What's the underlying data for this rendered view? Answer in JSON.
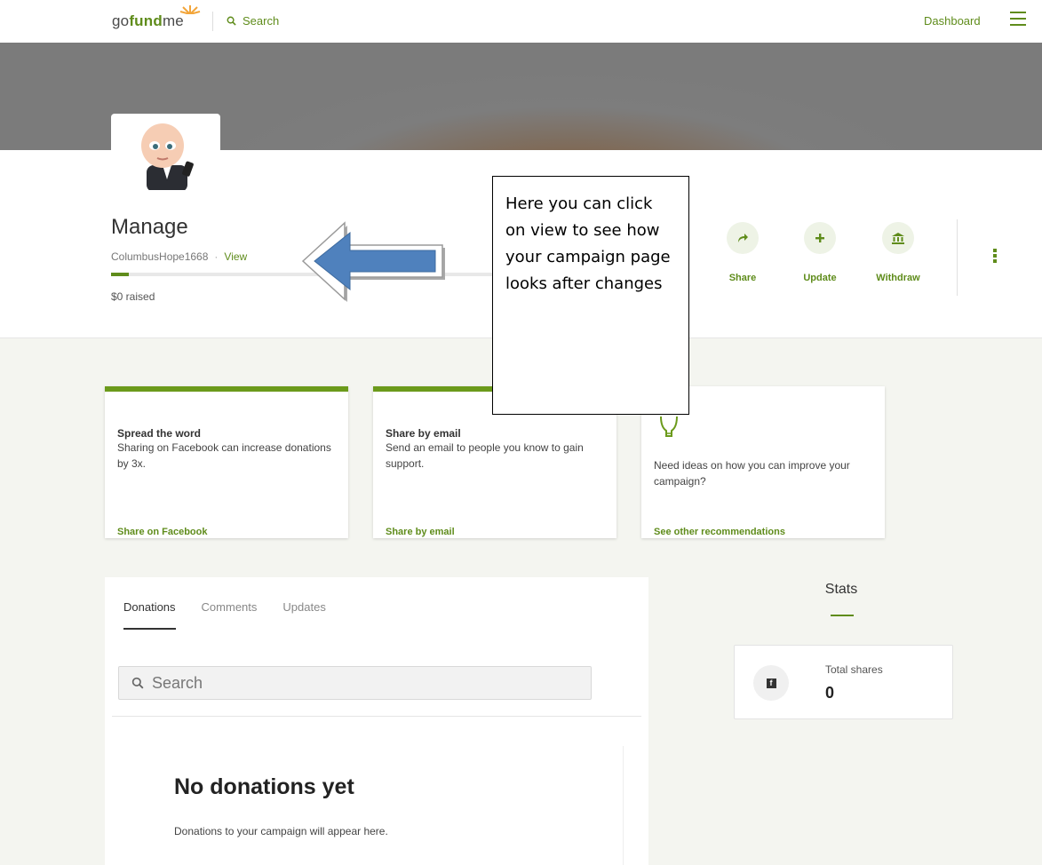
{
  "nav": {
    "logo_go": "go",
    "logo_fund": "fund",
    "logo_me": "me",
    "search_label": "Search",
    "dashboard_label": "Dashboard"
  },
  "campaign": {
    "title": "Manage",
    "username": "ColumbusHope1668",
    "separator": "·",
    "view_label": "View",
    "raised": "$0 raised",
    "progress_percent": 0
  },
  "actions": [
    {
      "label": "Share",
      "icon": "share-arrow-icon",
      "glyph": "➦"
    },
    {
      "label": "Update",
      "icon": "plus-icon",
      "glyph": "+"
    },
    {
      "label": "Withdraw",
      "icon": "bank-icon",
      "glyph": "🏛"
    }
  ],
  "cards": [
    {
      "title": "Spread the word",
      "body": "Sharing on Facebook can increase donations by 3x.",
      "link": "Share on Facebook"
    },
    {
      "title": "Share by email",
      "body": "Send an email to people you know to gain support.",
      "link": "Share by email"
    },
    {
      "title": "",
      "body": "Need ideas on how you can improve your campaign?",
      "link": "See other recommendations"
    }
  ],
  "tabs": [
    "Donations",
    "Comments",
    "Updates"
  ],
  "search_placeholder": "Search",
  "empty_state": {
    "title": "No donations yet",
    "subtitle": "Donations to your campaign will appear here."
  },
  "stats": {
    "title": "Stats",
    "total_shares_label": "Total shares",
    "total_shares_value": "0"
  },
  "annotation": {
    "text": "Here you can click on view to see how your campaign page looks after changes"
  },
  "colors": {
    "brand_green": "#5f8c1b",
    "background_grey": "#f4f5f0"
  }
}
